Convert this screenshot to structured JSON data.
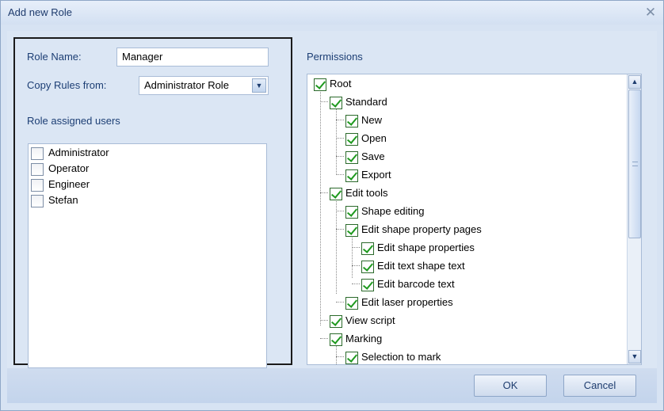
{
  "window": {
    "title": "Add new Role"
  },
  "form": {
    "role_name_label": "Role Name:",
    "role_name_value": "Manager",
    "copy_rules_label": "Copy Rules from:",
    "copy_rules_value": "Administrator Role",
    "assigned_users_label": "Role assigned users"
  },
  "users": [
    {
      "name": "Administrator",
      "checked": false
    },
    {
      "name": "Operator",
      "checked": false
    },
    {
      "name": "Engineer",
      "checked": false
    },
    {
      "name": "Stefan",
      "checked": false
    }
  ],
  "permissions": {
    "label": "Permissions",
    "nodes": [
      {
        "label": "Root",
        "level": 0,
        "checked": true
      },
      {
        "label": "Standard",
        "level": 1,
        "checked": true
      },
      {
        "label": "New",
        "level": 2,
        "checked": true
      },
      {
        "label": "Open",
        "level": 2,
        "checked": true
      },
      {
        "label": "Save",
        "level": 2,
        "checked": true
      },
      {
        "label": "Export",
        "level": 2,
        "checked": true
      },
      {
        "label": "Edit tools",
        "level": 1,
        "checked": true
      },
      {
        "label": "Shape editing",
        "level": 2,
        "checked": true
      },
      {
        "label": "Edit shape property pages",
        "level": 2,
        "checked": true
      },
      {
        "label": "Edit shape properties",
        "level": 3,
        "checked": true
      },
      {
        "label": "Edit text shape text",
        "level": 3,
        "checked": true
      },
      {
        "label": "Edit barcode text",
        "level": 3,
        "checked": true
      },
      {
        "label": "Edit laser properties",
        "level": 2,
        "checked": true
      },
      {
        "label": "View script",
        "level": 1,
        "checked": true
      },
      {
        "label": "Marking",
        "level": 1,
        "checked": true
      },
      {
        "label": "Selection to mark",
        "level": 2,
        "checked": true
      }
    ]
  },
  "buttons": {
    "ok": "OK",
    "cancel": "Cancel"
  },
  "icons": {
    "close": "close-icon",
    "dropdown": "chevron-down-icon",
    "scroll_up": "scroll-up-icon",
    "scroll_down": "scroll-down-icon"
  }
}
